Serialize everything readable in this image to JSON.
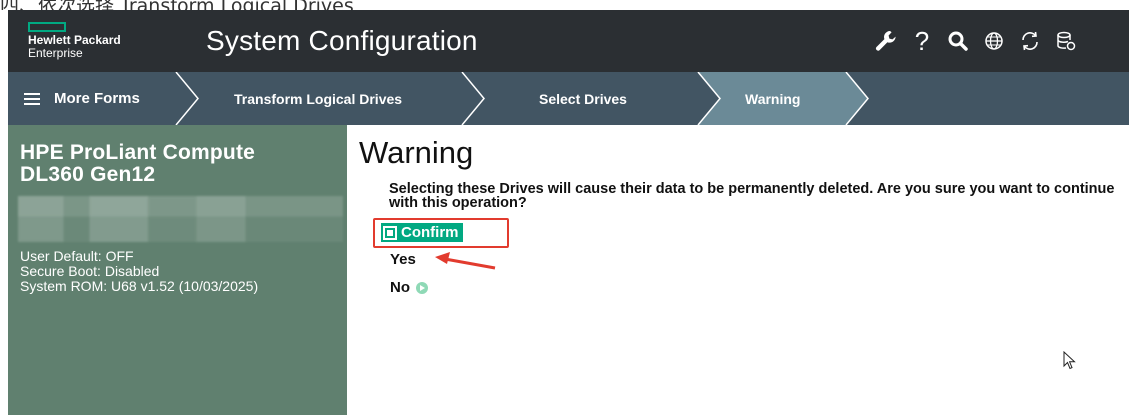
{
  "top_caption": "四、依次选择 Transform Logical Drives",
  "header": {
    "logo_line1": "Hewlett Packard",
    "logo_line2": "Enterprise",
    "title": "System Configuration",
    "icons": [
      "wrench-icon",
      "help-icon",
      "search-icon",
      "globe-icon",
      "refresh-icon",
      "database-icon"
    ],
    "help_glyph": "?"
  },
  "breadcrumb": {
    "menu_label": "More Forms",
    "items": [
      "Transform Logical Drives",
      "Select Drives",
      "Warning"
    ]
  },
  "sidebar": {
    "server_line1": "HPE ProLiant Compute",
    "server_line2": "DL360 Gen12",
    "user_default": "User Default: OFF",
    "secure_boot": "Secure Boot: Disabled",
    "system_rom": "System ROM: U68 v1.52 (10/03/2025)"
  },
  "main": {
    "title": "Warning",
    "message": "Selecting these Drives will cause their data to be permanently deleted. Are you sure you want to continue with this operation?",
    "confirm_label": "Confirm",
    "yes_label": "Yes",
    "no_label": "No"
  },
  "colors": {
    "header_bg": "#2b2f33",
    "breadcrumb_bg": "#425563",
    "breadcrumb_active": "#6b8a97",
    "sidebar_bg": "#60806f",
    "accent_green": "#01a982",
    "annotation_red": "#e23b2e"
  }
}
